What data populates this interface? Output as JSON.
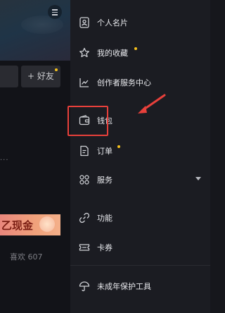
{
  "background": {
    "add_friend_label": "+ 好友",
    "ellipsis": "...",
    "cash_banner_text": "乙现金",
    "likes_text": "喜欢 607"
  },
  "drawer": {
    "items": [
      {
        "label": "个人名片",
        "icon": "contact-card-icon",
        "has_dot": false
      },
      {
        "label": "我的收藏",
        "icon": "star-icon",
        "has_dot": true
      },
      {
        "label": "创作者服务中心",
        "icon": "chart-line-icon",
        "has_dot": false
      },
      {
        "label": "钱包",
        "icon": "wallet-icon",
        "has_dot": false
      },
      {
        "label": "订单",
        "icon": "order-document-icon",
        "has_dot": true
      },
      {
        "label": "服务",
        "icon": "grid-services-icon",
        "has_dot": false,
        "expandable": true
      },
      {
        "label": "功能",
        "icon": "link-icon",
        "has_dot": false
      },
      {
        "label": "卡券",
        "icon": "coupon-icon",
        "has_dot": false
      },
      {
        "label": "未成年保护工具",
        "icon": "umbrella-icon",
        "has_dot": false
      }
    ]
  },
  "colors": {
    "drawer_bg": "#1b1c22",
    "text": "#e9eaee",
    "notify_dot": "#f7c21c",
    "annotation": "#e8403b"
  }
}
